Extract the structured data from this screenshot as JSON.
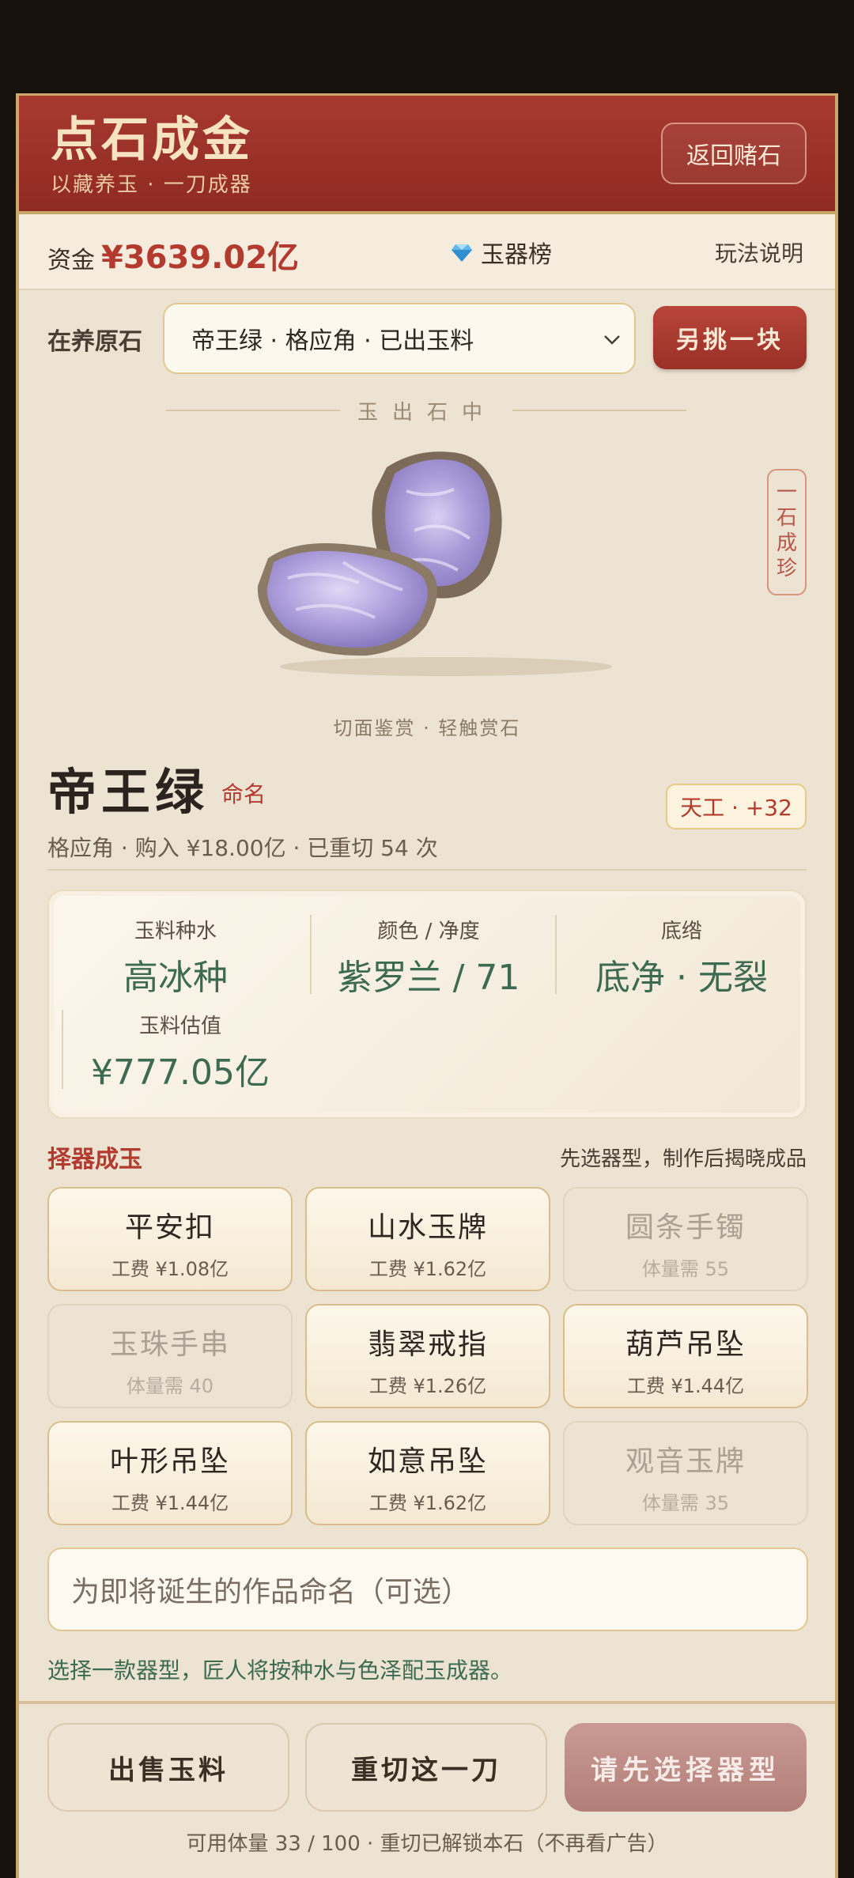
{
  "header": {
    "title": "点石成金",
    "subtitle": "以藏养玉 · 一刀成器",
    "back_button": "返回赌石"
  },
  "status_bar": {
    "funds_label": "资金",
    "funds_value": "¥3639.02亿",
    "ranking_label": "玉器榜",
    "rules_label": "玩法说明"
  },
  "stone_picker": {
    "label": "在养原石",
    "selected": "帝王绿 · 格应角 · 已出玉料",
    "pick_button": "另挑一块"
  },
  "showcase": {
    "divider_title": "玉出石中",
    "side_tag": "一石成珍",
    "caption": "切面鉴赏 · 轻触赏石"
  },
  "jade": {
    "name": "帝王绿",
    "rename_label": "命名",
    "badge": "天工 · +32",
    "meta": "格应角 · 购入 ¥18.00亿 · 已重切 54 次"
  },
  "stats": [
    {
      "label": "玉料种水",
      "value": "高冰种"
    },
    {
      "label": "颜色 / 净度",
      "value": "紫罗兰 / 71"
    },
    {
      "label": "底绺",
      "value": "底净 · 无裂"
    },
    {
      "label": "玉料估值",
      "value": "¥777.05亿"
    }
  ],
  "crafting": {
    "title": "择器成玉",
    "hint": "先选器型，制作后揭晓成品",
    "items": [
      {
        "name": "平安扣",
        "sub": "工费 ¥1.08亿",
        "enabled": true
      },
      {
        "name": "山水玉牌",
        "sub": "工费 ¥1.62亿",
        "enabled": true
      },
      {
        "name": "圆条手镯",
        "sub": "体量需 55",
        "enabled": false
      },
      {
        "name": "玉珠手串",
        "sub": "体量需 40",
        "enabled": false
      },
      {
        "name": "翡翠戒指",
        "sub": "工费 ¥1.26亿",
        "enabled": true
      },
      {
        "name": "葫芦吊坠",
        "sub": "工费 ¥1.44亿",
        "enabled": true
      },
      {
        "name": "叶形吊坠",
        "sub": "工费 ¥1.44亿",
        "enabled": true
      },
      {
        "name": "如意吊坠",
        "sub": "工费 ¥1.62亿",
        "enabled": true
      },
      {
        "name": "观音玉牌",
        "sub": "体量需 35",
        "enabled": false
      }
    ]
  },
  "name_input": {
    "placeholder": "为即将诞生的作品命名（可选）"
  },
  "tip": "选择一款器型，匠人将按种水与色泽配玉成器。",
  "actions": {
    "sell": "出售玉料",
    "recut": "重切这一刀",
    "confirm": "请先选择器型"
  },
  "footer": "可用体量 33 / 100 · 重切已解锁本石（不再看广告）",
  "colors": {
    "header_red": "#a83a30",
    "accent_red": "#b33a2e",
    "jade_green": "#3c6b52",
    "gold_border": "#c9a86a"
  }
}
